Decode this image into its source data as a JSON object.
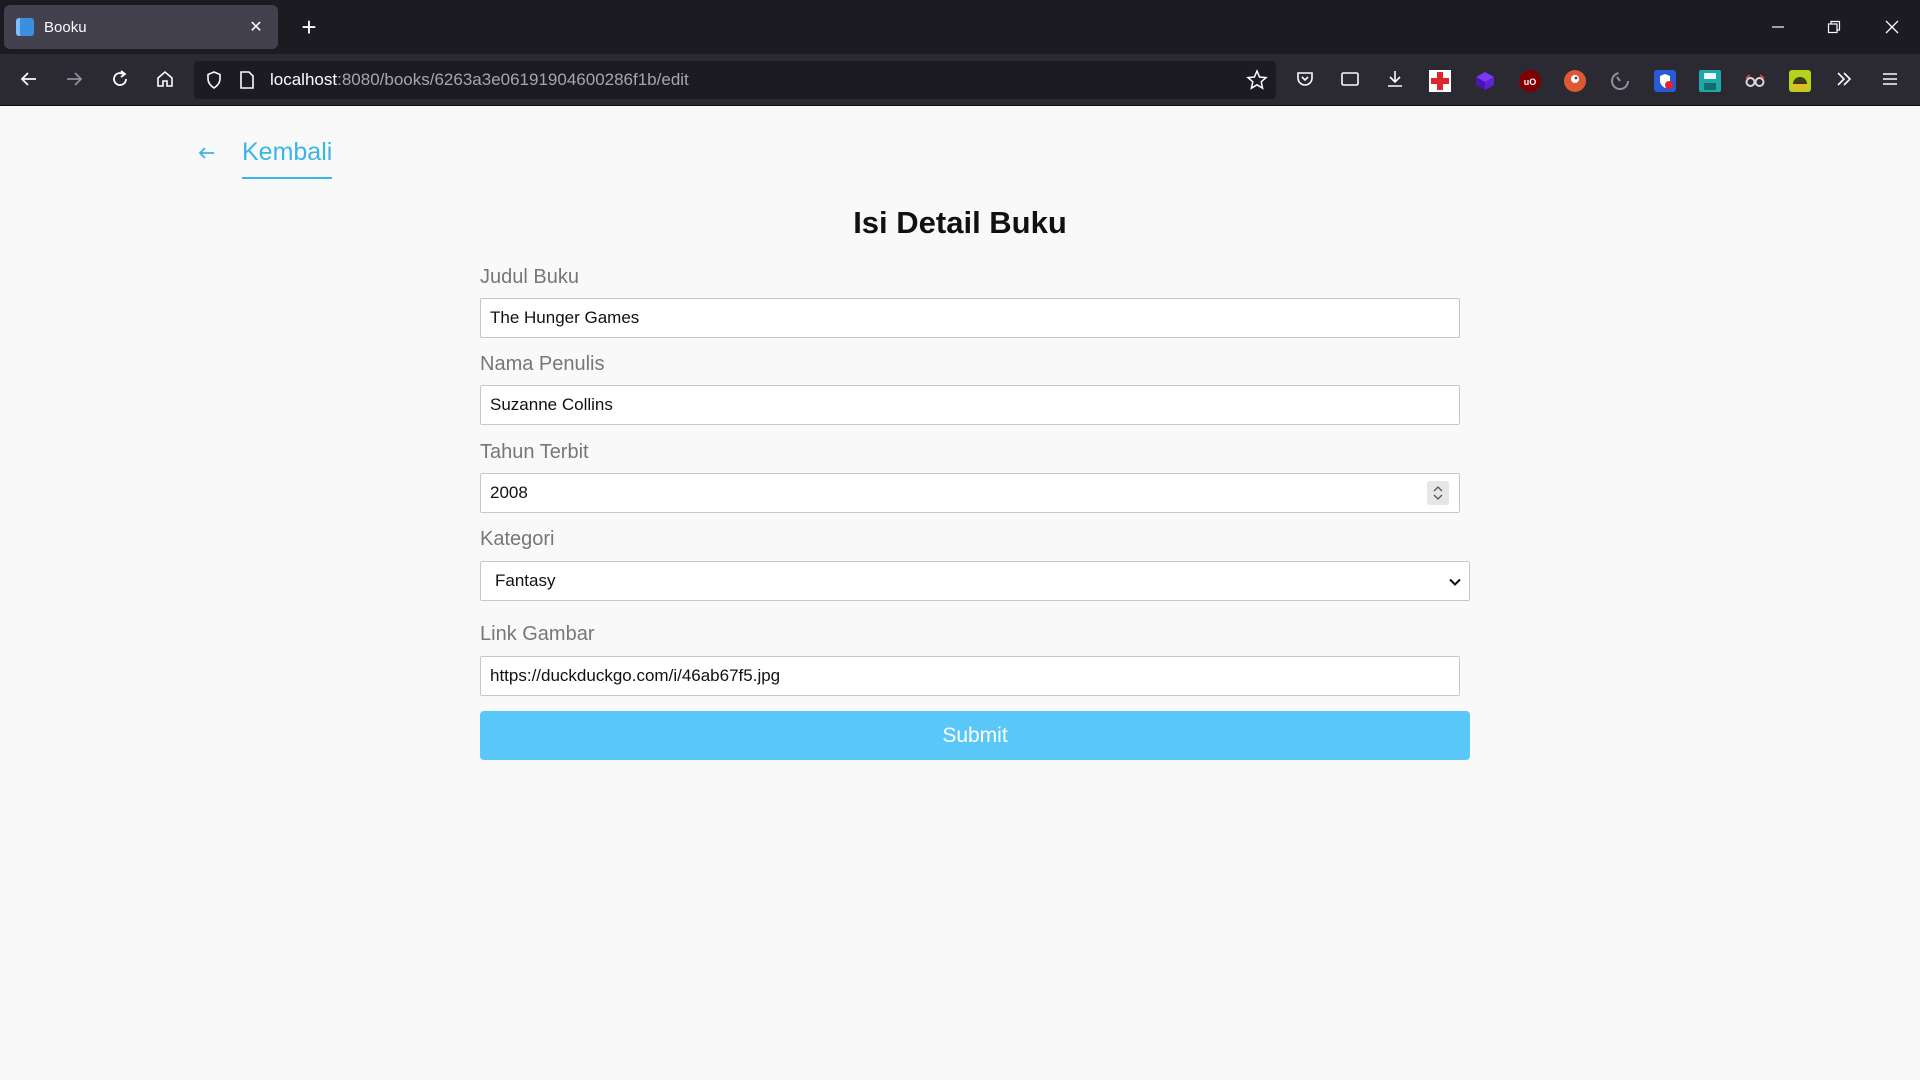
{
  "browser": {
    "tab_title": "Booku",
    "tab_close": "✕",
    "new_tab": "+",
    "url_host": "localhost",
    "url_path": ":8080/books/6263a3e06191904600286f1b/edit"
  },
  "page": {
    "back_label": "Kembali",
    "title": "Isi Detail Buku"
  },
  "form": {
    "judul": {
      "label": "Judul Buku",
      "value": "The Hunger Games"
    },
    "penulis": {
      "label": "Nama Penulis",
      "value": "Suzanne Collins"
    },
    "tahun": {
      "label": "Tahun Terbit",
      "value": "2008"
    },
    "kategori": {
      "label": "Kategori",
      "selected": "Fantasy"
    },
    "gambar": {
      "label": "Link Gambar",
      "value": "https://duckduckgo.com/i/46ab67f5.jpg"
    },
    "submit_label": "Submit"
  },
  "colors": {
    "accent": "#3ab6e6",
    "submit_bg": "#59c8f8",
    "chrome_dark": "#1c1b22",
    "chrome_bar": "#2b2a33"
  }
}
